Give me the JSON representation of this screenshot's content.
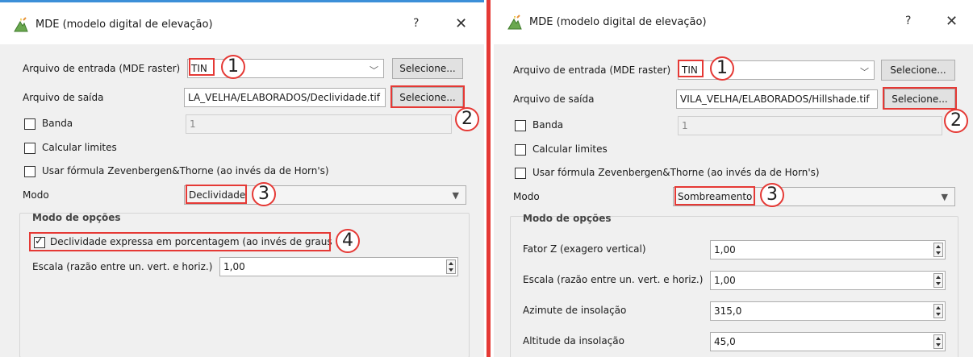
{
  "left": {
    "title": "MDE (modelo digital de elevação)",
    "help": "?",
    "close": "✕",
    "input_label": "Arquivo de entrada (MDE raster)",
    "input_value": "TIN",
    "output_label": "Arquivo de saída",
    "output_value": "LA_VELHA/ELABORADOS/Declividade.tif",
    "select_label": "Selecione...",
    "band_label": "Banda",
    "band_value": "1",
    "calc_limits_label": "Calcular limites",
    "zev_label": "Usar fórmula Zevenbergen&Thorne (ao invés da de Horn's)",
    "mode_label": "Modo",
    "mode_value": "Declividade",
    "options_title": "Modo de opções",
    "percent_label": "Declividade expressa em porcentagem (ao invés de graus",
    "scale_label": "Escala (razão entre un. vert. e horiz.)",
    "scale_value": "1,00",
    "markers": [
      "1",
      "2",
      "3",
      "4"
    ]
  },
  "right": {
    "title": "MDE (modelo digital de elevação)",
    "help": "?",
    "close": "✕",
    "input_label": "Arquivo de entrada (MDE raster)",
    "input_value": "TIN",
    "output_label": "Arquivo de saída",
    "output_value": "VILA_VELHA/ELABORADOS/Hillshade.tif",
    "select_label": "Selecione...",
    "band_label": "Banda",
    "band_value": "1",
    "calc_limits_label": "Calcular limites",
    "zev_label": "Usar fórmula Zevenbergen&Thorne (ao invés da de Horn's)",
    "mode_label": "Modo",
    "mode_value": "Sombreamento",
    "options_title": "Modo de opções",
    "z_label": "Fator Z (exagero vertical)",
    "z_value": "1,00",
    "scale_label": "Escala (razão entre un. vert. e horiz.)",
    "scale_value": "1,00",
    "azimuth_label": "Azimute de insolação",
    "azimuth_value": "315,0",
    "altitude_label": "Altitude da insolação",
    "altitude_value": "45,0",
    "markers": [
      "1",
      "2",
      "3"
    ]
  },
  "icons": {
    "app": "qgis-dem-icon",
    "combo": "chevron-down-icon",
    "spin": "spinner-arrows-icon",
    "check": "checkmark-icon"
  },
  "colors": {
    "highlight": "#e53935",
    "dialog_bg": "#f0f0f0",
    "titlebar_bg": "#ffffff",
    "accent": "#3c8fd8"
  }
}
